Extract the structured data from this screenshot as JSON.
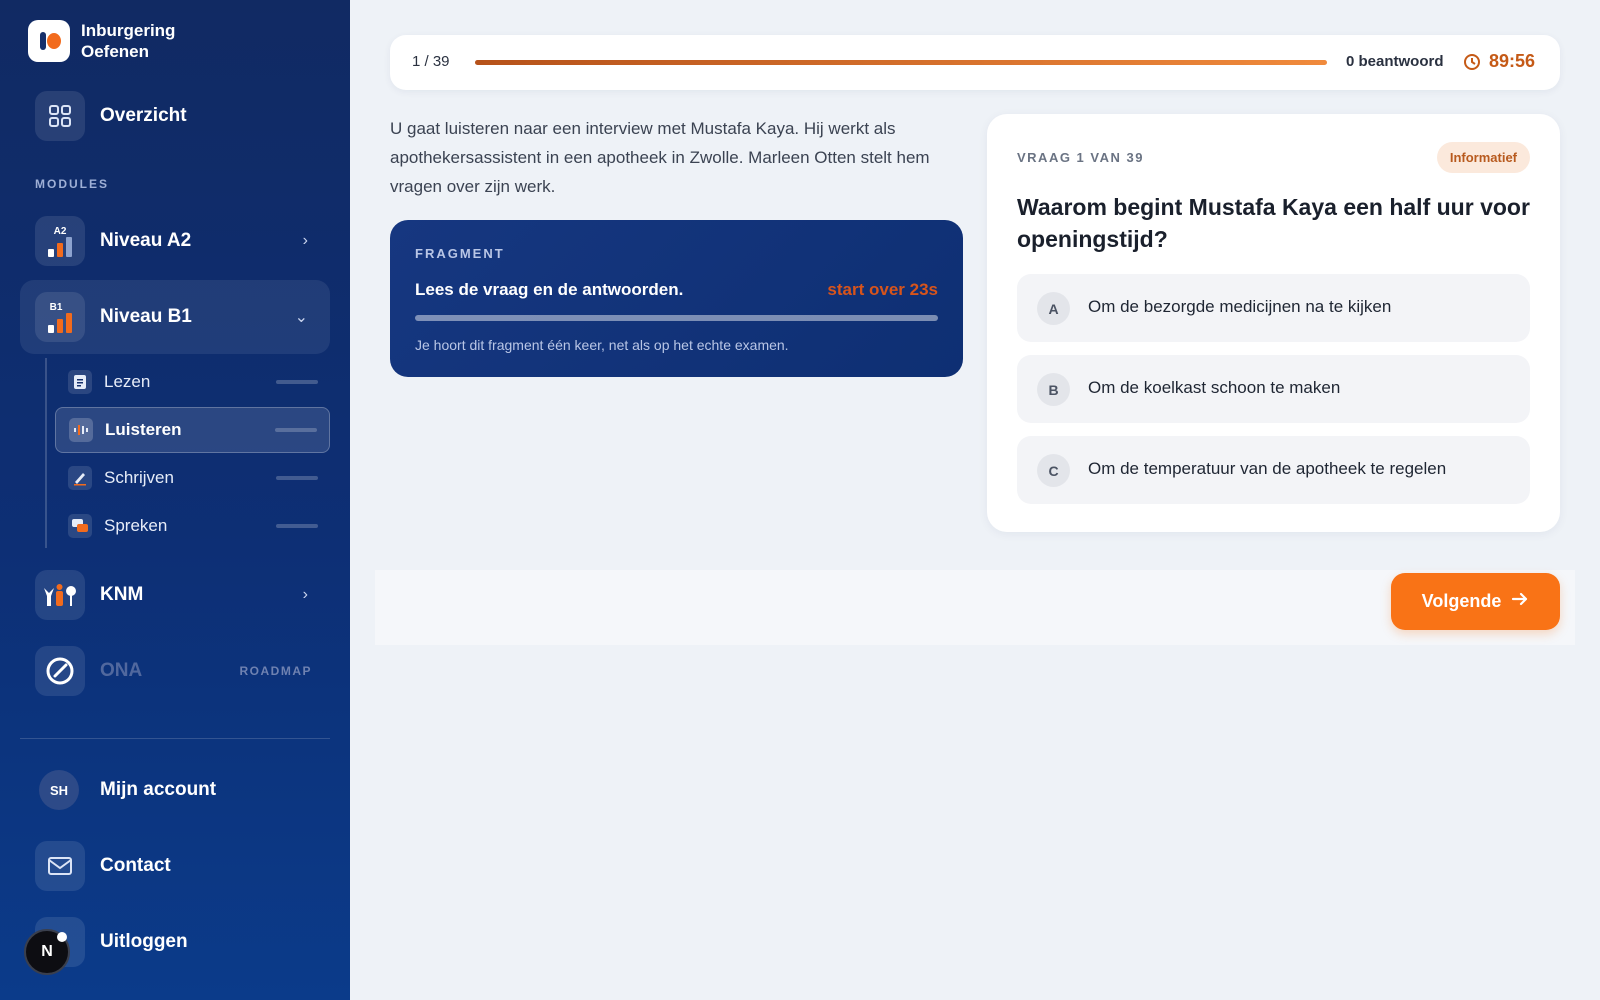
{
  "app": {
    "title_line1": "Inburgering",
    "title_line2": "Oefenen"
  },
  "sidebar": {
    "overview_label": "Overzicht",
    "modules_heading": "MODULES",
    "niveau_a2": {
      "label": "Niveau A2",
      "badge": "A2"
    },
    "niveau_b1": {
      "label": "Niveau B1",
      "badge": "B1"
    },
    "sub_items": [
      {
        "label": "Lezen"
      },
      {
        "label": "Luisteren"
      },
      {
        "label": "Schrijven"
      },
      {
        "label": "Spreken"
      }
    ],
    "knm_label": "KNM",
    "ona_label": "ONA",
    "roadmap_label": "ROADMAP",
    "account_initials": "SH",
    "account_label": "Mijn account",
    "contact_label": "Contact",
    "logout_label": "Uitloggen",
    "dev_badge": "N"
  },
  "progress": {
    "counter": "1 / 39",
    "answered": "0 beantwoord",
    "timer": "89:56",
    "fill_fraction": 1.0
  },
  "intro_text": "U gaat luisteren naar een interview met Mustafa Kaya. Hij werkt als apothekersassistent in een apotheek in Zwolle. Marleen Otten stelt hem vragen over zijn werk.",
  "fragment": {
    "tag": "FRAGMENT",
    "title": "Lees de vraag en de antwoorden.",
    "countdown": "start over 23s",
    "note": "Je hoort dit fragment één keer, net als op het echte examen."
  },
  "question": {
    "number": "VRAAG 1 VAN 39",
    "badge": "Informatief",
    "title": "Waarom begint Mustafa Kaya een half uur voor openingstijd?",
    "options": [
      {
        "letter": "A",
        "text": "Om de bezorgde medicijnen na te kijken"
      },
      {
        "letter": "B",
        "text": "Om de koelkast schoon te maken"
      },
      {
        "letter": "C",
        "text": "Om de temperatuur van de apotheek te regelen"
      }
    ]
  },
  "next_button": "Volgende",
  "colors": {
    "accent": "#f97316",
    "navy": "#112a63",
    "timer": "#c55a17"
  }
}
